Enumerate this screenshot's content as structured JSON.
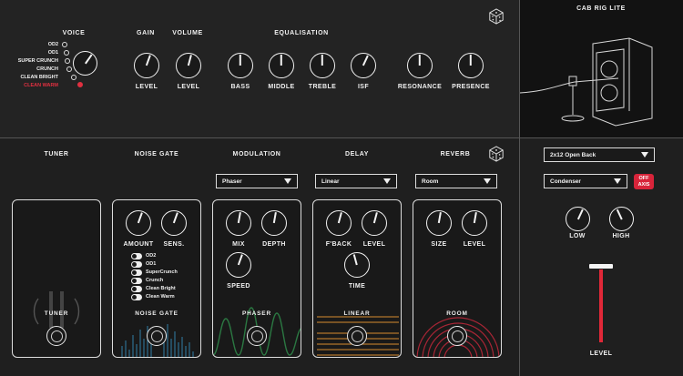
{
  "amp": {
    "voice": {
      "title": "VOICE",
      "options": [
        "OD2",
        "OD1",
        "SUPER CRUNCH",
        "CRUNCH",
        "CLEAN BRIGHT",
        "CLEAN WARM"
      ],
      "selected": "CLEAN WARM"
    },
    "gain_title": "GAIN",
    "volume_title": "VOLUME",
    "eq_title": "EQUALISATION",
    "knobs": {
      "gain": "LEVEL",
      "volume": "LEVEL",
      "bass": "BASS",
      "middle": "MIDDLE",
      "treble": "TREBLE",
      "isf": "ISF",
      "resonance": "RESONANCE",
      "presence": "PRESENCE"
    }
  },
  "cab": {
    "title": "CAB RIG LITE",
    "cabinet": "2x12 Open Back",
    "mic": "Condenser",
    "off_axis_line1": "OFF",
    "off_axis_line2": "AXIS",
    "low": "LOW",
    "high": "HIGH",
    "level": "LEVEL"
  },
  "effects": {
    "tuner": {
      "title": "TUNER",
      "pedal_name": "TUNER"
    },
    "noise_gate": {
      "title": "NOISE GATE",
      "amount": "AMOUNT",
      "sens": "SENS.",
      "voices": [
        "OD2",
        "OD1",
        "SuperCrunch",
        "Crunch",
        "Clean Bright",
        "Clean Warm"
      ],
      "pedal_name": "NOISE GATE"
    },
    "modulation": {
      "title": "MODULATION",
      "dropdown": "Phaser",
      "mix": "MIX",
      "depth": "DEPTH",
      "speed": "SPEED",
      "pedal_name": "PHASER"
    },
    "delay": {
      "title": "DELAY",
      "dropdown": "Linear",
      "feedback": "F'BACK",
      "level": "LEVEL",
      "time": "TIME",
      "pedal_name": "LINEAR"
    },
    "reverb": {
      "title": "REVERB",
      "dropdown": "Room",
      "size": "SIZE",
      "level": "LEVEL",
      "pedal_name": "ROOM"
    }
  },
  "colors": {
    "accent_red": "#e03040",
    "noise_gate_glow": "#3aa0d8",
    "phaser_wave": "#2f8a4a",
    "delay_lines": "#d88a30",
    "reverb_arcs": "#c0283a"
  }
}
